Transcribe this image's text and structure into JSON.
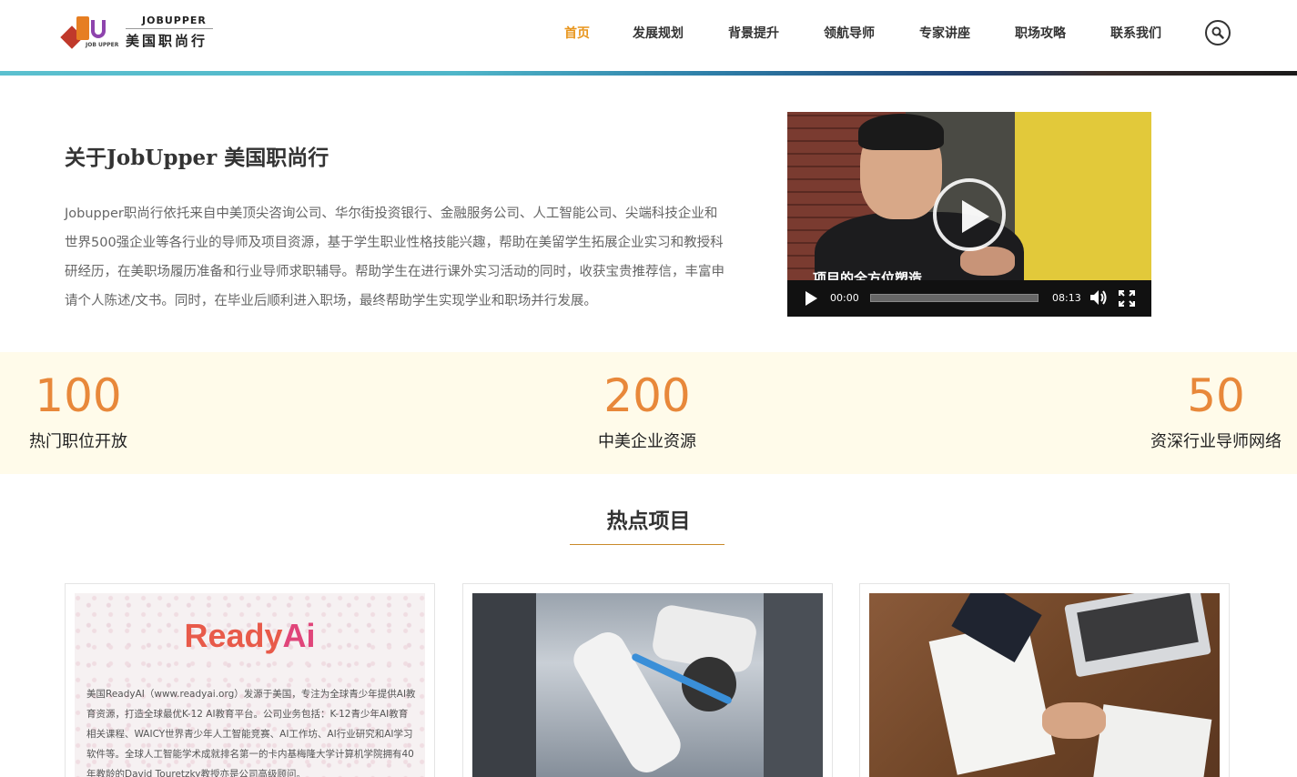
{
  "brand": {
    "name_en": "JOBUPPER",
    "name_cn": "美国职尚行",
    "mark_text": "JOB UPPER"
  },
  "nav": {
    "items": [
      {
        "label": "首页",
        "active": true
      },
      {
        "label": "发展规划",
        "active": false
      },
      {
        "label": "背景提升",
        "active": false
      },
      {
        "label": "领航导师",
        "active": false
      },
      {
        "label": "专家讲座",
        "active": false
      },
      {
        "label": "职场攻略",
        "active": false
      },
      {
        "label": "联系我们",
        "active": false
      }
    ],
    "search_icon": "search-icon"
  },
  "about": {
    "title": "关于JobUpper 美国职尚行",
    "text": "Jobupper职尚行依托来自中美顶尖咨询公司、华尔街投资银行、金融服务公司、人工智能公司、尖端科技企业和世界500强企业等各行业的导师及项目资源，基于学生职业性格技能兴趣，帮助在美留学生拓展企业实习和教授科研经历，在美职场履历准备和行业导师求职辅导。帮助学生在进行课外实习活动的同时，收获宝贵推荐信，丰富申请个人陈述/文书。同时，在毕业后顺利进入职场，最终帮助学生实现学业和职场并行发展。"
  },
  "video": {
    "caption": "项目的全方位塑造",
    "current_time": "00:00",
    "duration": "08:13",
    "progress": 0
  },
  "stats": [
    {
      "value": "100",
      "label": "热门职位开放"
    },
    {
      "value": "200",
      "label": "中美企业资源"
    },
    {
      "value": "50",
      "label": "资深行业导师网络"
    }
  ],
  "section": {
    "title": "热点项目"
  },
  "cards": [
    {
      "logo_ready": "Ready",
      "logo_ai": "Ai",
      "text": "美国ReadyAI（www.readyai.org）发源于美国，专注为全球青少年提供AI教育资源，打造全球最优K-12 AI教育平台。公司业务包括：K-12青少年AI教育相关课程、WAICY世界青少年人工智能竞赛、AI工作坊、AI行业研究和AI学习软件等。全球人工智能学术成就排名第一的卡内基梅隆大学计算机学院拥有40年教龄的David Touretzky教授亦是公司高级顾问。"
    },
    {},
    {}
  ],
  "colors": {
    "accent": "#e8951c",
    "stat_number": "#e8883a",
    "stats_bg": "#fffbea",
    "section_rule": "#c98a2a"
  }
}
